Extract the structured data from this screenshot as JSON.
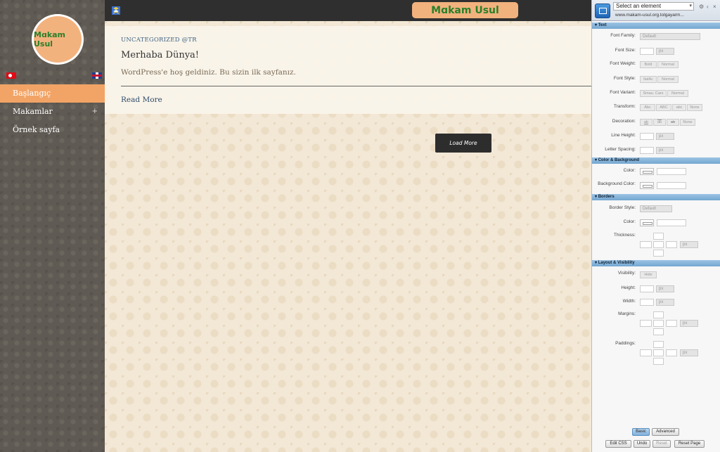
{
  "site": {
    "logo_text": "Mɑkam Usul",
    "header_logo_text": "Mɑkam Usul"
  },
  "sidebar": {
    "items": [
      {
        "label": "Başlangıç",
        "active": true
      },
      {
        "label": "Makamlar",
        "has_children": true,
        "expand_icon": "+"
      },
      {
        "label": "Örnek sayfa"
      }
    ],
    "flags": [
      "turkish-flag",
      "uk-flag"
    ]
  },
  "post": {
    "category": "UNCATEGORIZED @TR",
    "title": "Merhaba Dünya!",
    "excerpt": "WordPress'e hoş geldiniz. Bu sizin ilk sayfanız.",
    "read_more": "Read More"
  },
  "load_more": "Load More",
  "panel": {
    "element_select": "Select an element",
    "url": "www.makam-usul.org.tolgayarm...",
    "sections": {
      "text": "Text",
      "color_bg": "Color & Background",
      "borders": "Borders",
      "layout": "Layout & Visibility"
    },
    "labels": {
      "font_family": "Font Family:",
      "font_size": "Font Size:",
      "font_weight": "Font Weight:",
      "font_style": "Font Style:",
      "font_variant": "Font Variant:",
      "transform": "Transform:",
      "decoration": "Decoration:",
      "line_height": "Line Height:",
      "letter_spacing": "Letter Spacing:",
      "color": "Color:",
      "background_color": "Background Color:",
      "border_style": "Border Style:",
      "border_color": "Color:",
      "thickness": "Thickness:",
      "visibility": "Visibility:",
      "height": "Height:",
      "width": "Width:",
      "margins": "Margins:",
      "paddings": "Paddings:"
    },
    "values": {
      "default": "Default",
      "px": "px",
      "bold": "Bold",
      "normal": "Normal",
      "italic": "ItalAc",
      "small_caps": "Smau. Cars",
      "abc_cap": "Abc",
      "abc_upper": "ABC",
      "abc_lower": "abc",
      "none": "None",
      "dec_ul": "ab",
      "dec_ol": "ab",
      "dec_lt": "ab",
      "hide": "Hide"
    },
    "footer": {
      "basic": "Basic",
      "advanced": "Advanced",
      "edit_css": "Edit CSS",
      "undo": "Undo",
      "reset": "Reset",
      "reset_page": "Reset Page"
    }
  }
}
